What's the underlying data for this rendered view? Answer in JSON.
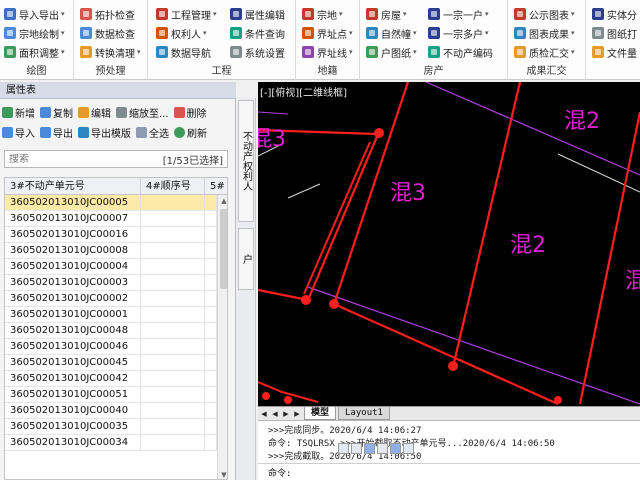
{
  "ribbon": {
    "groups": [
      {
        "caption": "绘图",
        "items": [
          "导入导出",
          "宗地绘制",
          "面积调整"
        ]
      },
      {
        "caption": "预处理",
        "items": [
          "拓扑检查",
          "数据检查",
          "转换清理"
        ]
      },
      {
        "caption": "工程",
        "items": [
          "工程管理",
          "权利人",
          "数据导航",
          "属性编辑",
          "条件查询",
          "系统设置"
        ]
      },
      {
        "caption": "地籍",
        "items": [
          "宗地",
          "界址点",
          "界址线"
        ]
      },
      {
        "caption": "房产",
        "items": [
          "房屋",
          "自然幢",
          "户图纸",
          "一宗一户",
          "一宗多户",
          "不动产编码"
        ]
      },
      {
        "caption": "成果汇交",
        "items": [
          "公示图表",
          "图表成果",
          "质检汇交"
        ]
      },
      {
        "caption": "",
        "items": [
          "实体分",
          "图纸打",
          "文件量"
        ]
      }
    ]
  },
  "panel": {
    "title": "属性表",
    "toolbar1": [
      "新增",
      "复制",
      "编辑",
      "缩放至...",
      "删除"
    ],
    "toolbar2": [
      "导入",
      "导出",
      "导出模版",
      "全选",
      "刷新"
    ],
    "search_placeholder": "搜索",
    "search_count": "[1/53已选择]",
    "columns": [
      "3#不动产单元号",
      "4#顺序号",
      "5#"
    ],
    "rows": [
      "360502013010JC00005",
      "360502013010JC00007",
      "360502013010JC00016",
      "360502013010JC00008",
      "360502013010JC00004",
      "360502013010JC00003",
      "360502013010JC00002",
      "360502013010JC00001",
      "360502013010JC00048",
      "360502013010JC00046",
      "360502013010JC00045",
      "360502013010JC00042",
      "360502013010JC00051",
      "360502013010JC00040",
      "360502013010JC00035",
      "360502013010JC00034"
    ],
    "selected_row": 0,
    "side_tabs": [
      "不动产权利人",
      "户"
    ]
  },
  "viewport": {
    "label": "[-][俯视][二维线框]",
    "texts": [
      "混3",
      "混2",
      "混3",
      "混2",
      "混"
    ]
  },
  "layout_tabs": [
    "模型",
    "Layout1"
  ],
  "command": {
    "lines": [
      ">>>完成同步。2020/6/4 14:06:27",
      "命令: TSQLRSX >>>开始截取不动产单元号...2020/6/4 14:06:50",
      ">>>完成截取。2020/6/4 14:06:50"
    ],
    "prompt": "命令:"
  },
  "colors": {
    "accent": "#3c6fc4",
    "selection": "#fde9a8",
    "cad_lines": "#ff1e1e",
    "cad_text": "#e020d0",
    "cad_boundary": "#b040e0"
  }
}
